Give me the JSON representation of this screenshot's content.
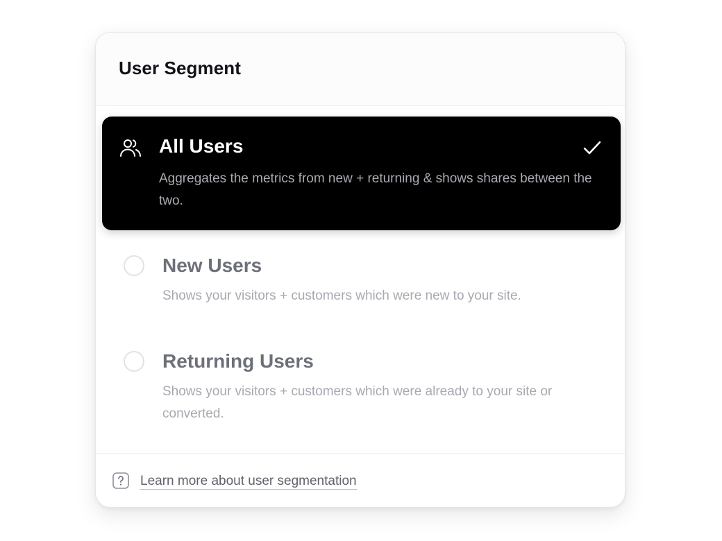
{
  "header": {
    "title": "User Segment"
  },
  "options": [
    {
      "title": "All Users",
      "description": "Aggregates the metrics from new + returning & shows shares between the two.",
      "selected": true,
      "icon": "users-icon"
    },
    {
      "title": "New Users",
      "description": "Shows your visitors + customers which were new to your site.",
      "selected": false
    },
    {
      "title": "Returning Users",
      "description": "Shows your visitors + customers which were already to your site or converted.",
      "selected": false
    }
  ],
  "footer": {
    "help_icon": "question-mark-icon",
    "link_text": "Learn more about user segmentation"
  },
  "colors": {
    "selected_bg": "#000000",
    "title_text": "#111318",
    "muted_title": "#6d7079",
    "muted_desc": "#a7a9b0"
  }
}
